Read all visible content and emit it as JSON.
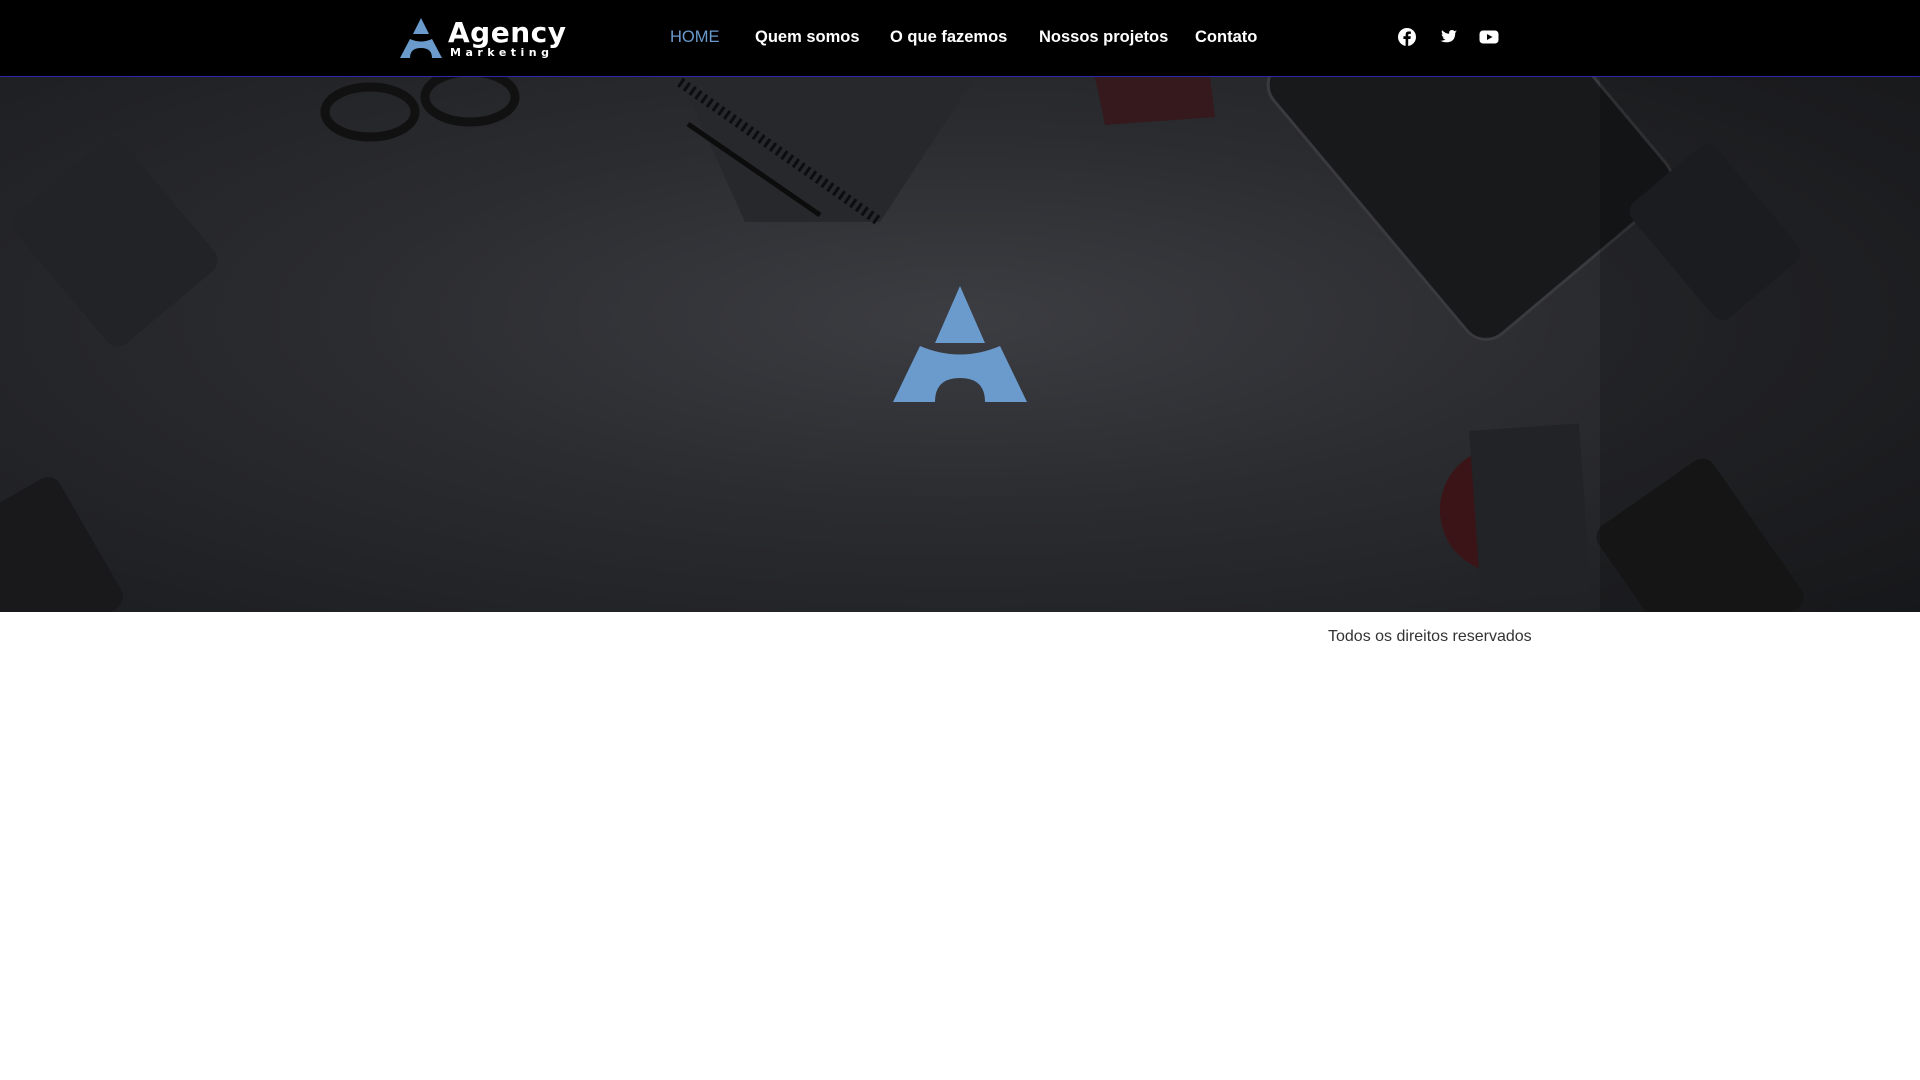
{
  "brand": {
    "name": "Agency",
    "tagline": "Marketing",
    "accent_color": "#6a9bcc"
  },
  "nav": {
    "items": [
      {
        "label": "HOME",
        "active": true
      },
      {
        "label": "Quem somos",
        "active": false
      },
      {
        "label": "O que fazemos",
        "active": false
      },
      {
        "label": "Nossos projetos",
        "active": false
      },
      {
        "label": "Contato",
        "active": false
      }
    ]
  },
  "social": [
    {
      "icon": "facebook-icon"
    },
    {
      "icon": "twitter-icon"
    },
    {
      "icon": "youtube-icon"
    }
  ],
  "hero": {
    "background": "dark desk photo",
    "logo_icon": "agency-a-logo-icon"
  },
  "footer": {
    "text": "Todos os direitos reservados"
  }
}
